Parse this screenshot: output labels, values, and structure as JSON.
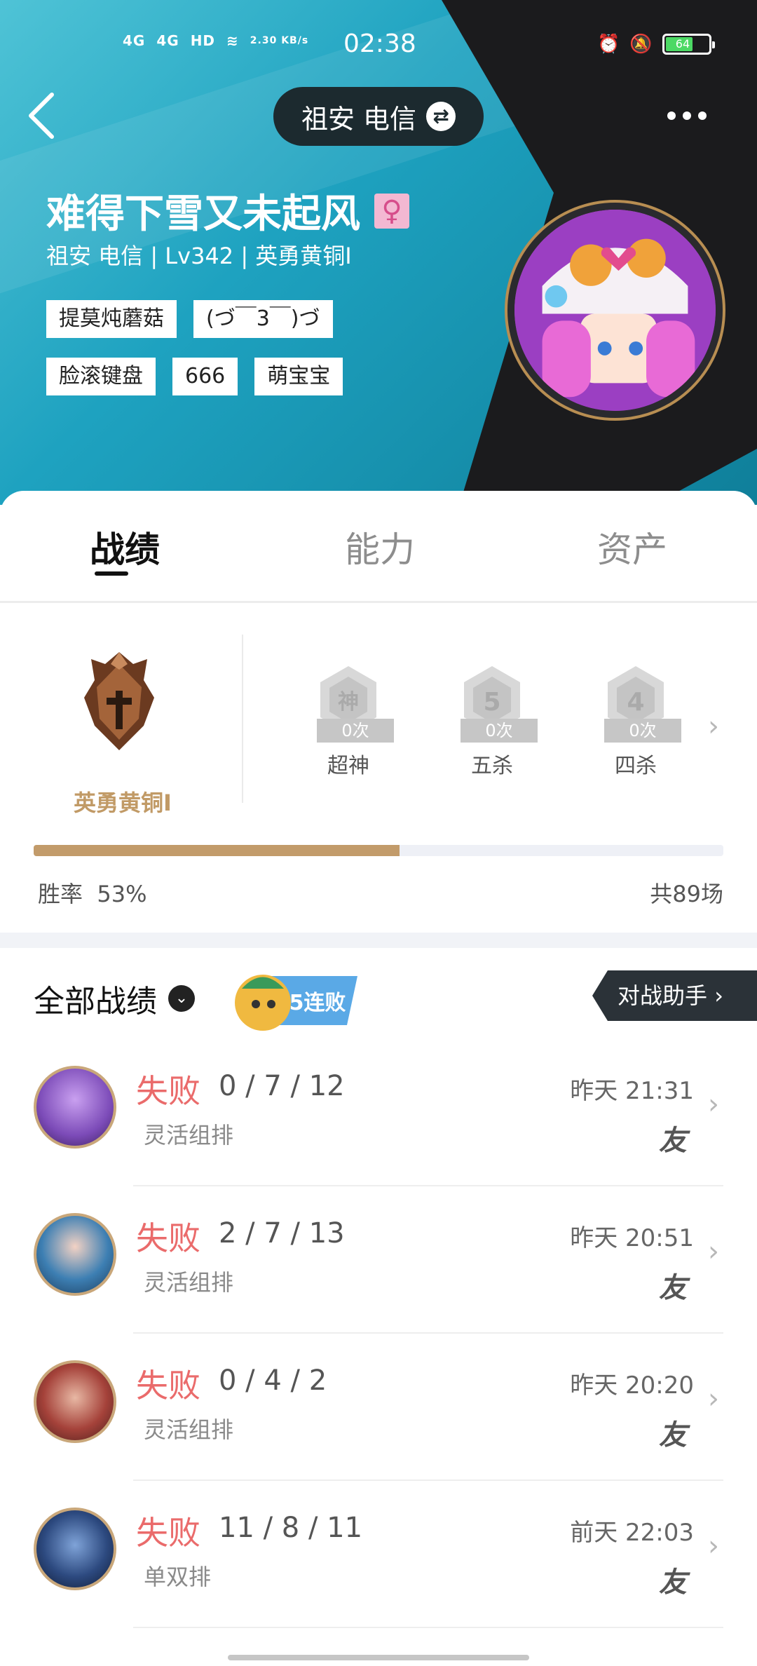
{
  "status_bar": {
    "signal1": "4G",
    "signal2": "4G",
    "hd": "HD",
    "net_speed": "2.30 KB/s",
    "time": "02:38",
    "battery": "64"
  },
  "header": {
    "region": "祖安 电信",
    "back_icon": "chevron-left-icon",
    "more_icon": "more-dots-icon"
  },
  "profile": {
    "name": "难得下雪又未起风",
    "gender_icon": "♀",
    "sub_info": "祖安 电信 | Lv342 | 英勇黄铜I",
    "tags": [
      [
        "提莫炖蘑菇",
        "(づ￣3￣)づ"
      ],
      [
        "脸滚键盘",
        "666",
        "萌宝宝"
      ]
    ]
  },
  "tabs": {
    "items": [
      "战绩",
      "能力",
      "资产"
    ],
    "active": "战绩"
  },
  "rank": {
    "name": "英勇黄铜I",
    "badges": [
      {
        "count": "0次",
        "label": "超神",
        "glyph": "神"
      },
      {
        "count": "0次",
        "label": "五杀",
        "glyph": "5"
      },
      {
        "count": "0次",
        "label": "四杀",
        "glyph": "4"
      }
    ],
    "win_rate_label": "胜率",
    "win_rate_value": "53%",
    "win_rate_fraction": 0.53,
    "total": "共89场"
  },
  "matches_header": {
    "title": "全部战绩",
    "streak_badge": "5连败",
    "assistant": "对战助手"
  },
  "matches": [
    {
      "result": "失败",
      "kda": "0 / 7 / 12",
      "mode": "灵活组排",
      "time": "昨天 21:31",
      "tag": "友"
    },
    {
      "result": "失败",
      "kda": "2 / 7 / 13",
      "mode": "灵活组排",
      "time": "昨天 20:51",
      "tag": "友"
    },
    {
      "result": "失败",
      "kda": "0 / 4 / 2",
      "mode": "灵活组排",
      "time": "昨天 20:20",
      "tag": "友"
    },
    {
      "result": "失败",
      "kda": "11 / 8 / 11",
      "mode": "单双排",
      "time": "前天 22:03",
      "tag": "友"
    }
  ],
  "colors": {
    "hero_teal": "#1ea2c0",
    "dark_panel": "#1b1b1d",
    "bronze": "#c29b6a",
    "loss_red": "#ea6b6b"
  }
}
